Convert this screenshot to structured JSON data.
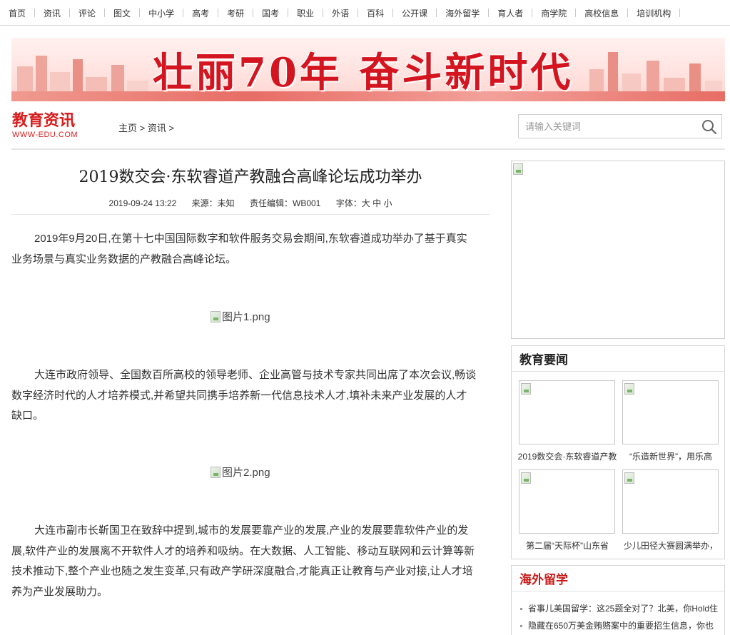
{
  "nav": [
    "首页",
    "资讯",
    "评论",
    "图文",
    "中小学",
    "高考",
    "考研",
    "国考",
    "职业",
    "外语",
    "百科",
    "公开课",
    "海外留学",
    "育人者",
    "商学院",
    "高校信息",
    "培训机构"
  ],
  "banner": {
    "title": "壮丽70年 奋斗新时代"
  },
  "logo": {
    "cn": "教育资讯",
    "en": "WWW-EDU.COM"
  },
  "breadcrumb": "主页 > 资讯 >",
  "search": {
    "placeholder": "请输入关键词"
  },
  "article": {
    "title": "2019数交会·东软睿道产教融合高峰论坛成功举办",
    "date": "2019-09-24 13:22",
    "source": "来源：未知",
    "editor": "责任编辑：WB001",
    "font_label": "字体：",
    "font_large": "大",
    "font_medium": "中",
    "font_small": "小",
    "p1": "2019年9月20日,在第十七中国国际数字和软件服务交易会期间,东软睿道成功举办了基于真实业务场景与真实业务数据的产教融合高峰论坛。",
    "img1": "图片1.png",
    "p2": "大连市政府领导、全国数百所高校的领导老师、企业高管与技术专家共同出席了本次会议,畅谈数字经济时代的人才培养模式,并希望共同携手培养新一代信息技术人才,填补未来产业发展的人才缺口。",
    "img2": "图片2.png",
    "p3": "大连市副市长靳国卫在致辞中提到,城市的发展要靠产业的发展,产业的发展要靠软件产业的发展,软件产业的发展离不开软件人才的培养和吸纳。在大数据、人工智能、移动互联网和云计算等新技术推动下,整个产业也随之发生变革,只有政产学研深度融合,才能真正让教育与产业对接,让人才培养为产业发展助力。"
  },
  "sidebar": {
    "news_title": "教育要闻",
    "news_items": [
      "2019数交会·东软睿道产教",
      "“乐造新世界”，用乐高",
      "第二届“天际杯”山东省",
      "少儿田径大赛圆满举办，"
    ],
    "abroad_title": "海外留学",
    "abroad_items": [
      "省事儿美国留学：这25题全对了？北美，你Hold住",
      "隐藏在650万美金贿赂案中的重要招生信息，你也"
    ]
  },
  "colors": {
    "brand_red": "#d81e1e",
    "abroad_red": "#c81a1a"
  }
}
